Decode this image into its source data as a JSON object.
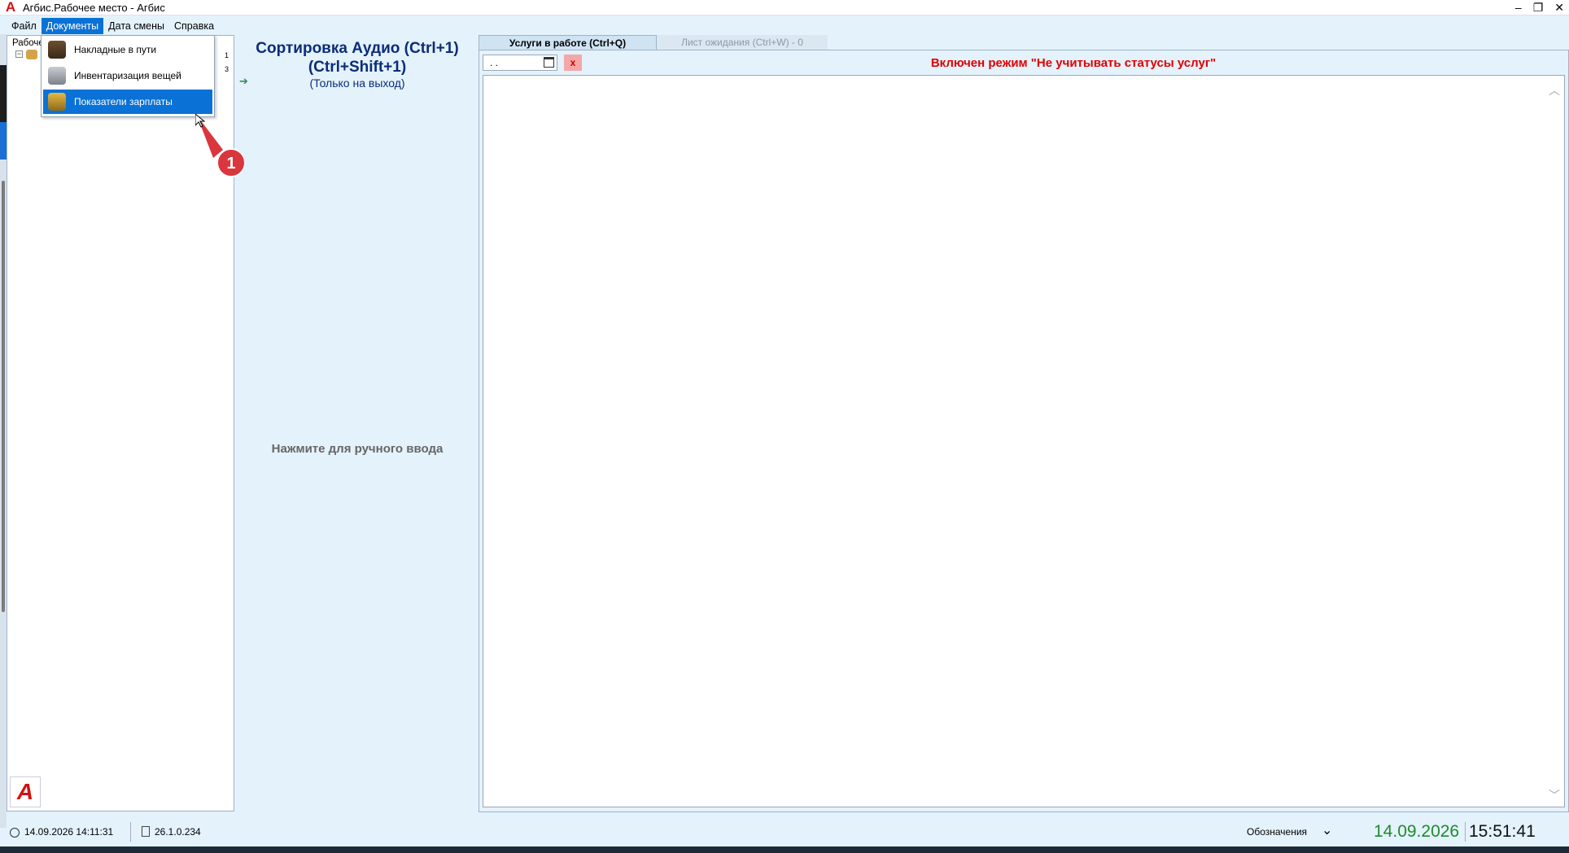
{
  "window": {
    "title": "Агбис.Рабочее место - Агбис",
    "logo_glyph": "A",
    "minimize": "–",
    "restore": "❐",
    "close": "✕"
  },
  "menu": {
    "items": [
      "Файл",
      "Документы",
      "Дата смены",
      "Справка"
    ],
    "active_index": 1
  },
  "tree": {
    "root_label": "Рабоче",
    "expander": "−",
    "side_numbers": [
      "1",
      "3"
    ]
  },
  "dropdown": {
    "items": [
      {
        "label": "Накладные в пути",
        "icon": "truck-icon"
      },
      {
        "label": "Инвентаризация вещей",
        "icon": "inventory-icon"
      },
      {
        "label": "Показатели зарплаты",
        "icon": "salary-coins-icon"
      }
    ],
    "highlighted_index": 2
  },
  "callout": {
    "number": "1",
    "color": "#d9363e"
  },
  "center": {
    "title_line1": "Сортировка Аудио (Ctrl+1)",
    "title_line2": "(Ctrl+Shift+1)",
    "subtitle": "(Только на выход)",
    "manual_entry": "Нажмите для ручного ввода"
  },
  "tabs": {
    "active": "Услуги в работе (Ctrl+Q)",
    "inactive": "Лист ожидания (Ctrl+W) - 0"
  },
  "work": {
    "date_value": ". .",
    "clear_label": "x",
    "mode_banner": "Включен режим \"Не учитывать статусы услуг\""
  },
  "status": {
    "shift_start": "14.09.2026 14:11:31",
    "version": "26.1.0.234",
    "legend_label": "Обозначения",
    "date": "14.09.2026",
    "time": "15:51:41"
  },
  "colors": {
    "accent": "#0a72d6",
    "banner": "#e00000",
    "date_green": "#1f8a2a",
    "title_navy": "#0b2c7a"
  }
}
